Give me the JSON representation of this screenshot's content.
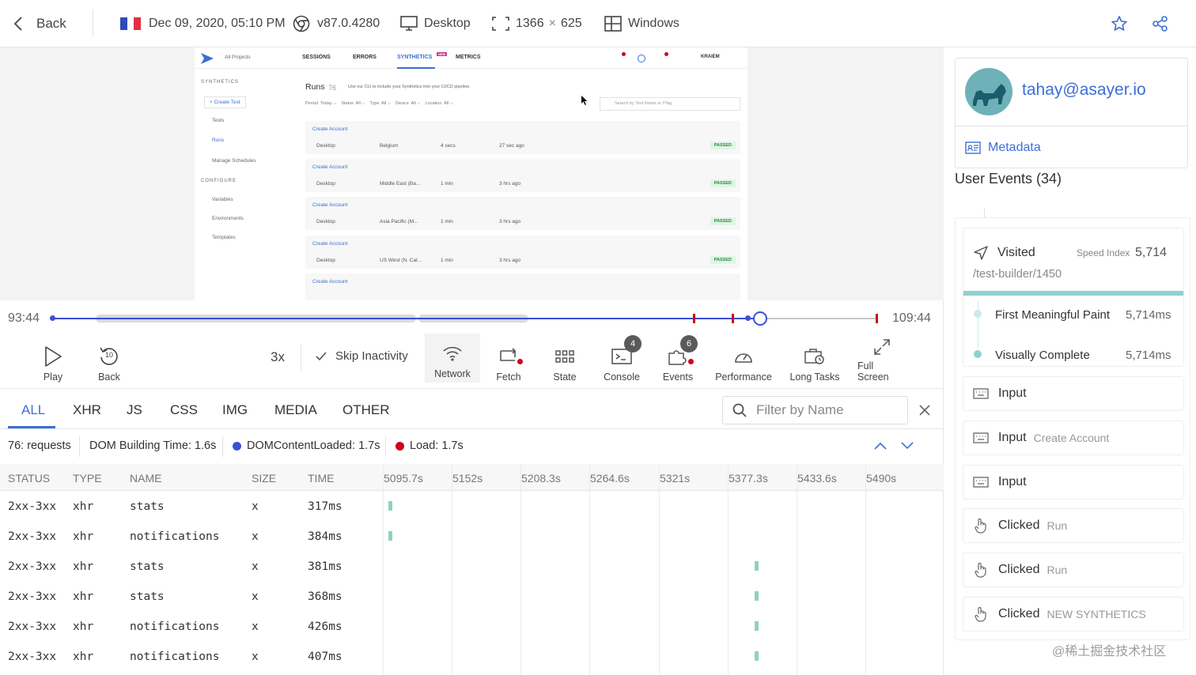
{
  "topbar": {
    "back_label": "Back",
    "date": "Dec 09, 2020, 05:10 PM",
    "browser_version": "v87.0.4280",
    "device": "Desktop",
    "resolution_w": "1366",
    "resolution_x": "×",
    "resolution_h": "625",
    "os": "Windows",
    "flag_colors": [
      "#2d4bb8",
      "#ffffff",
      "#e03140"
    ]
  },
  "preview": {
    "nav": {
      "projects": "All Projects",
      "sessions": "SESSIONS",
      "errors": "ERRORS",
      "synthetics": "SYNTHETICS",
      "new_badge": "NEW",
      "metrics": "METRICS",
      "user": "KRAIEM"
    },
    "sidebar": {
      "section1": "SYNTHETICS",
      "create": "+ Create Test",
      "tests": "Tests",
      "runs": "Runs",
      "schedules": "Manage Schedules",
      "section2": "CONFIGURE",
      "variables": "Variables",
      "environments": "Environments",
      "templates": "Templates"
    },
    "runs_title": "Runs",
    "runs_count": "76",
    "cli_note": "Use our CLI to include your Synthetics into your CI/CD pipeline.",
    "filters": "Period  Today ⌵    Status  All ⌵    Type  All ⌵    Device  All ⌵    Location  All ⌵",
    "search_placeholder": "Search by Test Name or #Tag",
    "runs": [
      {
        "name": "Create Account",
        "device": "Desktop",
        "location": "Belgium",
        "duration": "4 secs",
        "ago": "27 sec ago",
        "status": "PASSED"
      },
      {
        "name": "Create Account",
        "device": "Desktop",
        "location": "Middle East (Ba...",
        "duration": "1 min",
        "ago": "3 hrs ago",
        "status": "PASSED"
      },
      {
        "name": "Create Account",
        "device": "Desktop",
        "location": "Asia Pacific (M...",
        "duration": "1 min",
        "ago": "3 hrs ago",
        "status": "PASSED"
      },
      {
        "name": "Create Account",
        "device": "Desktop",
        "location": "US West (N. Cal...",
        "duration": "1 min",
        "ago": "3 hrs ago",
        "status": "PASSED"
      },
      {
        "name": "Create Account",
        "device": "",
        "location": "",
        "duration": "",
        "ago": "",
        "status": ""
      }
    ]
  },
  "timeline": {
    "current_time": "93:44",
    "end_time": "109:44",
    "progress_fraction": 0.857,
    "speed": "3x",
    "skip_inactivity": "Skip Inactivity",
    "buttons": {
      "play": "Play",
      "back": "Back",
      "network": "Network",
      "fetch": "Fetch",
      "state": "State",
      "console": "Console",
      "events": "Events",
      "performance": "Performance",
      "long_tasks": "Long Tasks",
      "full_screen": "Full Screen"
    },
    "back_seconds": "10",
    "console_count": "4",
    "events_count": "6"
  },
  "network": {
    "tabs": [
      "ALL",
      "XHR",
      "JS",
      "CSS",
      "IMG",
      "MEDIA",
      "OTHER"
    ],
    "filter_placeholder": "Filter by Name",
    "summary": {
      "requests_count": "76",
      "requests_label": ": requests",
      "dom_building_label": "DOM Building Time:",
      "dom_building_value": "1.6s",
      "dcl_label": "DOMContentLoaded:",
      "dcl_value": "1.7s",
      "load_label": "Load:",
      "load_value": "1.7s",
      "dcl_color": "#3d4fd6",
      "load_color": "#d0021b"
    },
    "columns": [
      "STATUS",
      "TYPE",
      "NAME",
      "SIZE",
      "TIME"
    ],
    "waterfall_ticks": [
      "5095.7s",
      "5152s",
      "5208.3s",
      "5264.6s",
      "5321s",
      "5377.3s",
      "5433.6s",
      "5490s"
    ],
    "rows": [
      {
        "status": "2xx-3xx",
        "type": "xhr",
        "name": "stats",
        "size": "x",
        "time": "317ms"
      },
      {
        "status": "2xx-3xx",
        "type": "xhr",
        "name": "notifications",
        "size": "x",
        "time": "384ms"
      },
      {
        "status": "2xx-3xx",
        "type": "xhr",
        "name": "stats",
        "size": "x",
        "time": "381ms"
      },
      {
        "status": "2xx-3xx",
        "type": "xhr",
        "name": "stats",
        "size": "x",
        "time": "368ms"
      },
      {
        "status": "2xx-3xx",
        "type": "xhr",
        "name": "notifications",
        "size": "x",
        "time": "426ms"
      },
      {
        "status": "2xx-3xx",
        "type": "xhr",
        "name": "notifications",
        "size": "x",
        "time": "407ms"
      }
    ]
  },
  "sidebar": {
    "email": "tahay@asayer.io",
    "metadata": "Metadata",
    "events_title": "User Events (34)",
    "visited_label": "Visited",
    "speed_index_label": "Speed Index",
    "speed_index_value": "5,714",
    "visited_path": "/test-builder/1450",
    "fmp_label": "First Meaningful Paint",
    "fmp_value": "5,714ms",
    "vc_label": "Visually Complete",
    "vc_value": "5,714ms",
    "events": [
      {
        "label": "Input",
        "sub": ""
      },
      {
        "label": "Input",
        "sub": "Create Account"
      },
      {
        "label": "Input",
        "sub": ""
      },
      {
        "label": "Clicked",
        "sub": "Run"
      },
      {
        "label": "Clicked",
        "sub": "Run"
      },
      {
        "label": "Clicked",
        "sub": "NEW SYNTHETICS"
      }
    ]
  },
  "watermark": "@稀土掘金技术社区"
}
